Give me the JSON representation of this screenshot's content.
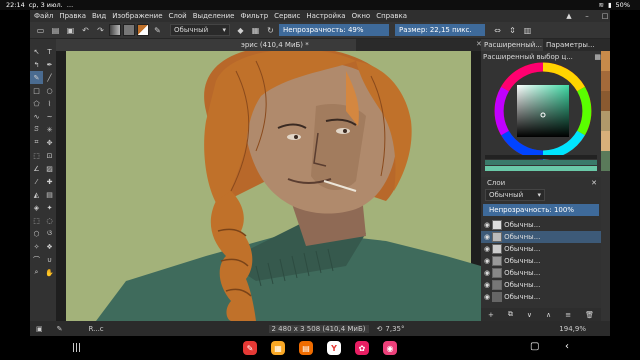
{
  "statusbar": {
    "time": "22:14",
    "date": "ср, 3 июл.",
    "dots": "…",
    "battery": "50%"
  },
  "menu": {
    "items": [
      "Файл",
      "Правка",
      "Вид",
      "Изображение",
      "Слой",
      "Выделение",
      "Фильтр",
      "Сервис",
      "Настройка",
      "Окно",
      "Справка"
    ]
  },
  "toolbar": {
    "blend_mode": "Обычный",
    "opacity_label": "Непрозрачность: 49%",
    "opacity_level": 0.49,
    "size_label": "Размер: 22,15 пикс."
  },
  "document": {
    "tab_title": "эрис (410,4 МиБ) *"
  },
  "panels": {
    "top_tabs": [
      "Расширенный...",
      "Параметры..."
    ],
    "color_selector_title": "Расширенный выбор ц...",
    "layers_title": "Слои",
    "layer_blend_mode": "Обычный",
    "layer_opacity_label": "Непрозрачность: 100%",
    "layers": [
      {
        "name": "Обычны..."
      },
      {
        "name": "Обычны..."
      },
      {
        "name": "Обычны..."
      },
      {
        "name": "Обычны..."
      },
      {
        "name": "Обычны..."
      },
      {
        "name": "Обычны..."
      },
      {
        "name": "Обычны..."
      }
    ]
  },
  "bottombar": {
    "left_status": "R...c",
    "image_info": "2 480 x 3 508 (410,4 МиБ)",
    "rotation": "7,35°",
    "zoom": "194,9%"
  },
  "colors": {
    "accent": "#3e6a9a",
    "canvas_bg": "#a3b27a",
    "hair": "#c0712a",
    "skin": "#b08a6c",
    "sweater": "#3f6b5c"
  }
}
